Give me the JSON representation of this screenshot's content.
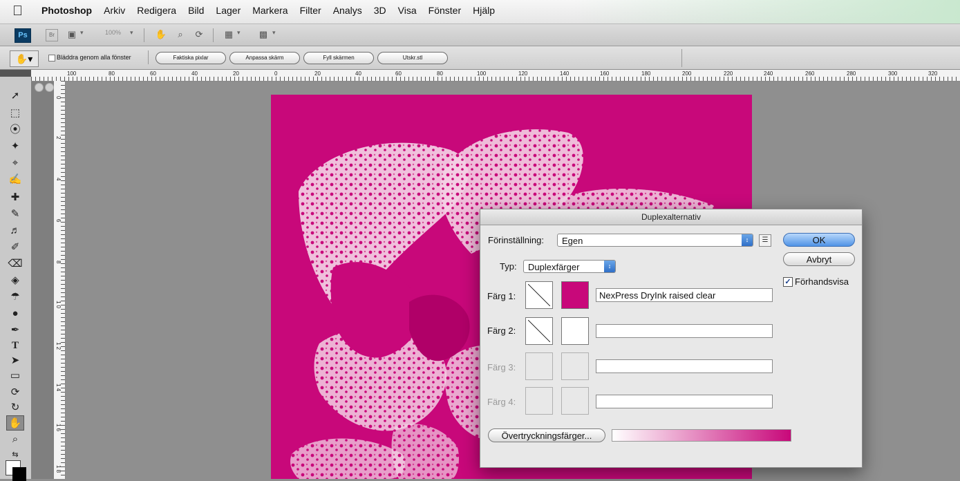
{
  "menubar": {
    "app_name": "Photoshop",
    "items": [
      "Arkiv",
      "Redigera",
      "Bild",
      "Lager",
      "Markera",
      "Filter",
      "Analys",
      "3D",
      "Visa",
      "Fönster",
      "Hjälp"
    ]
  },
  "appbar": {
    "logo": "Ps",
    "br_label": "Br",
    "zoom_label": "100%"
  },
  "optionsbar": {
    "scroll_all_label": "Bläddra genom alla fönster",
    "buttons": [
      "Faktiska pixlar",
      "Anpassa skärm",
      "Fyll skärmen",
      "Utskr.stl"
    ]
  },
  "ruler": {
    "h_labels": [
      "100",
      "80",
      "60",
      "40",
      "20",
      "0",
      "20",
      "40",
      "60",
      "80",
      "100",
      "120",
      "140",
      "160",
      "180",
      "200",
      "220",
      "240",
      "260",
      "280",
      "300",
      "320"
    ],
    "v_labels": [
      "0",
      "2",
      "4",
      "6",
      "8",
      "1\n0",
      "1\n2",
      "1\n4",
      "1\n6",
      "1\n8"
    ]
  },
  "colors": {
    "duplex_ink": "#c8087a",
    "menu_fade": "#c9e8cf"
  },
  "dialog": {
    "title": "Duplexalternativ",
    "preset_label": "Förinställning:",
    "preset_value": "Egen",
    "type_label": "Typ:",
    "type_value": "Duplexfärger",
    "ok_label": "OK",
    "cancel_label": "Avbryt",
    "preview_label": "Förhandsvisa",
    "preview_checked": true,
    "inks": [
      {
        "label": "Färg 1:",
        "name": "NexPress DryInk raised clear",
        "enabled": true
      },
      {
        "label": "Färg 2:",
        "name": "",
        "enabled": true
      },
      {
        "label": "Färg 3:",
        "name": "",
        "enabled": false
      },
      {
        "label": "Färg 4:",
        "name": "",
        "enabled": false
      }
    ],
    "overprint_label": "Övertryckningsfärger..."
  }
}
